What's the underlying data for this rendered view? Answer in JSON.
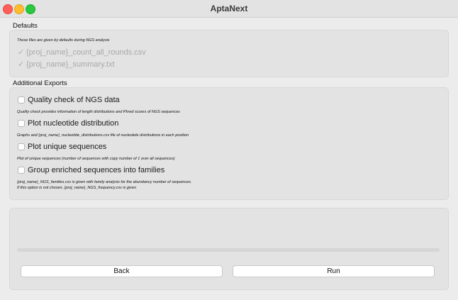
{
  "window": {
    "title": "AptaNext"
  },
  "defaults": {
    "heading": "Defaults",
    "note": "These files are given by defaults during NGS analysis",
    "files": [
      {
        "check": "✓",
        "label": "{proj_name}_count_all_rounds.csv"
      },
      {
        "check": "✓",
        "label": "{proj_name}_summary.txt"
      }
    ]
  },
  "exports": {
    "heading": "Additional Exports",
    "options": [
      {
        "label": "Quality check of NGS data",
        "checked": false,
        "note": "Quality check provides information of length distributions and Phred scores of NGS sequences"
      },
      {
        "label": "Plot nucleotide distribution",
        "checked": false,
        "note": "Graphs and {proj_name}_nucleotide_distributions.csv file of nucleotide distributions in each position"
      },
      {
        "label": "Plot unique sequences",
        "checked": false,
        "note": "Plot of unique sequences (number of sequences with copy number of 1 over all sequences)"
      },
      {
        "label": "Group enriched sequences into families",
        "checked": false,
        "note": "{proj_name}_NGS_families.csv is given with family analysis for the abundancy number of sequences.",
        "note2": " If this option is not chosen, {proj_name}_NGS_frequency.csv is given"
      }
    ]
  },
  "footer": {
    "progress": 0,
    "back_label": "Back",
    "run_label": "Run"
  }
}
